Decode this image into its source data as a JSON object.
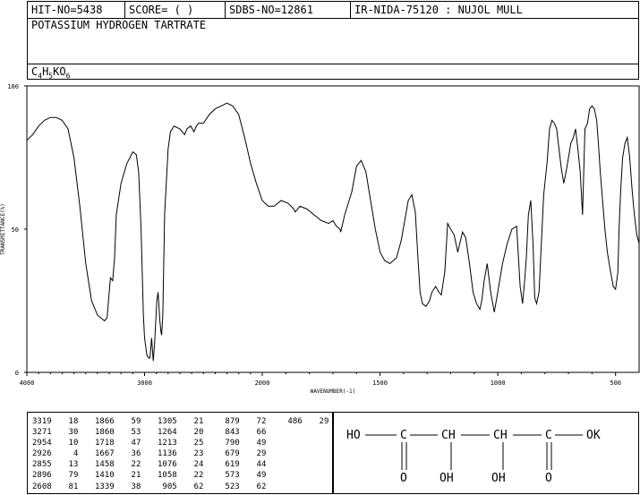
{
  "header": {
    "hit_no": "HIT-NO=5438",
    "score": "SCORE=  (   )",
    "sdbs_no": "SDBS-NO=12861",
    "ir_nida": "IR-NIDA-75120 : NUJOL MULL",
    "compound": "POTASSIUM HYDROGEN TARTRATE",
    "formula_parts": [
      "C",
      "4",
      "H",
      "5",
      "KO",
      "6"
    ]
  },
  "chart_data": {
    "type": "line",
    "xlabel": "WAVENUMBER(-1)",
    "ylabel": "TRANSMITTANCE(%)",
    "xlim": [
      4000,
      400
    ],
    "ylim": [
      0,
      100
    ],
    "x_ticks": [
      "4000",
      "3000",
      "2000",
      "1500",
      "1000",
      "500"
    ],
    "y_ticks": [
      "100",
      "50",
      "0"
    ],
    "grid": false,
    "line_color": "#000000",
    "x": [
      4000,
      3950,
      3900,
      3850,
      3800,
      3750,
      3700,
      3650,
      3600,
      3550,
      3500,
      3450,
      3400,
      3370,
      3340,
      3319,
      3300,
      3290,
      3271,
      3255,
      3240,
      3200,
      3150,
      3100,
      3070,
      3050,
      3030,
      3010,
      3000,
      2980,
      2965,
      2954,
      2940,
      2926,
      2915,
      2900,
      2896,
      2885,
      2870,
      2860,
      2855,
      2845,
      2830,
      2800,
      2780,
      2750,
      2700,
      2660,
      2640,
      2608,
      2580,
      2560,
      2540,
      2500,
      2450,
      2400,
      2350,
      2300,
      2250,
      2200,
      2150,
      2100,
      2050,
      2000,
      1975,
      1950,
      1920,
      1890,
      1866,
      1860,
      1840,
      1810,
      1780,
      1750,
      1718,
      1700,
      1685,
      1670,
      1667,
      1650,
      1620,
      1600,
      1580,
      1560,
      1540,
      1520,
      1500,
      1480,
      1458,
      1430,
      1410,
      1395,
      1380,
      1365,
      1350,
      1339,
      1330,
      1320,
      1305,
      1290,
      1280,
      1264,
      1250,
      1240,
      1225,
      1213,
      1200,
      1185,
      1170,
      1150,
      1136,
      1120,
      1105,
      1090,
      1076,
      1068,
      1058,
      1045,
      1030,
      1015,
      1000,
      980,
      960,
      940,
      920,
      905,
      895,
      885,
      879,
      870,
      860,
      850,
      843,
      835,
      825,
      815,
      805,
      795,
      790,
      785,
      780,
      770,
      760,
      750,
      740,
      730,
      720,
      710,
      700,
      690,
      679,
      670,
      660,
      650,
      640,
      630,
      619,
      610,
      600,
      590,
      580,
      573,
      565,
      555,
      545,
      535,
      523,
      510,
      500,
      490,
      485,
      478,
      470,
      460,
      450,
      440,
      430,
      420,
      410,
      400
    ],
    "y": [
      81,
      83,
      86,
      88,
      89,
      89,
      88,
      85,
      75,
      58,
      38,
      25,
      20,
      19,
      18,
      19,
      28,
      33,
      32,
      40,
      55,
      66,
      73,
      77,
      76,
      70,
      50,
      20,
      12,
      6,
      5,
      5,
      12,
      4,
      10,
      22,
      25,
      28,
      18,
      14,
      13,
      20,
      55,
      78,
      84,
      86,
      85,
      83,
      85,
      86,
      84,
      86,
      87,
      87,
      90,
      92,
      93,
      94,
      93,
      90,
      82,
      73,
      66,
      60,
      58,
      58,
      60,
      59,
      57,
      56,
      58,
      57,
      55,
      53,
      52,
      53,
      51,
      50,
      49,
      55,
      63,
      72,
      74,
      70,
      60,
      50,
      42,
      39,
      38,
      40,
      46,
      53,
      60,
      62,
      56,
      40,
      28,
      24,
      23,
      25,
      28,
      30,
      28,
      27,
      35,
      52,
      50,
      48,
      42,
      49,
      47,
      38,
      28,
      24,
      22,
      25,
      32,
      38,
      28,
      21,
      28,
      38,
      45,
      50,
      51,
      30,
      24,
      33,
      40,
      55,
      60,
      44,
      26,
      24,
      28,
      45,
      62,
      70,
      74,
      80,
      85,
      88,
      87,
      85,
      78,
      71,
      66,
      70,
      75,
      80,
      82,
      85,
      78,
      70,
      55,
      85,
      87,
      92,
      93,
      92,
      88,
      80,
      70,
      60,
      50,
      42,
      36,
      30,
      29,
      35,
      50,
      64,
      75,
      80,
      82,
      75,
      64,
      55,
      48,
      45,
      50,
      60,
      68,
      70,
      64,
      56,
      50,
      44,
      50,
      60,
      72,
      81,
      81,
      65,
      45,
      33,
      29,
      28,
      31,
      35,
      48,
      60,
      72,
      80,
      84,
      86,
      83,
      75,
      60,
      52
    ]
  },
  "peaks": [
    [
      "3319",
      "18"
    ],
    [
      "3271",
      "30"
    ],
    [
      "2954",
      "10"
    ],
    [
      "2926",
      "4"
    ],
    [
      "2855",
      "13"
    ],
    [
      "2896",
      "79"
    ],
    [
      "2608",
      "81"
    ],
    [
      "1866",
      "59"
    ],
    [
      "1860",
      "53"
    ],
    [
      "1718",
      "47"
    ],
    [
      "1667",
      "36"
    ],
    [
      "1458",
      "22"
    ],
    [
      "1410",
      "21"
    ],
    [
      "1339",
      "38"
    ],
    [
      "1305",
      "21"
    ],
    [
      "1264",
      "20"
    ],
    [
      "1213",
      "25"
    ],
    [
      "1136",
      "23"
    ],
    [
      "1076",
      "24"
    ],
    [
      "1058",
      "22"
    ],
    [
      "905",
      "62"
    ],
    [
      "879",
      "72"
    ],
    [
      "843",
      "66"
    ],
    [
      "790",
      "49"
    ],
    [
      "679",
      "29"
    ],
    [
      "619",
      "44"
    ],
    [
      "573",
      "49"
    ],
    [
      "523",
      "62"
    ],
    [
      "486",
      "29"
    ]
  ],
  "structure": {
    "top_row": [
      "HO",
      "C",
      "CH",
      "CH",
      "C",
      "OK"
    ],
    "bottom_row": [
      "O",
      "OH",
      "OH",
      "O"
    ]
  }
}
